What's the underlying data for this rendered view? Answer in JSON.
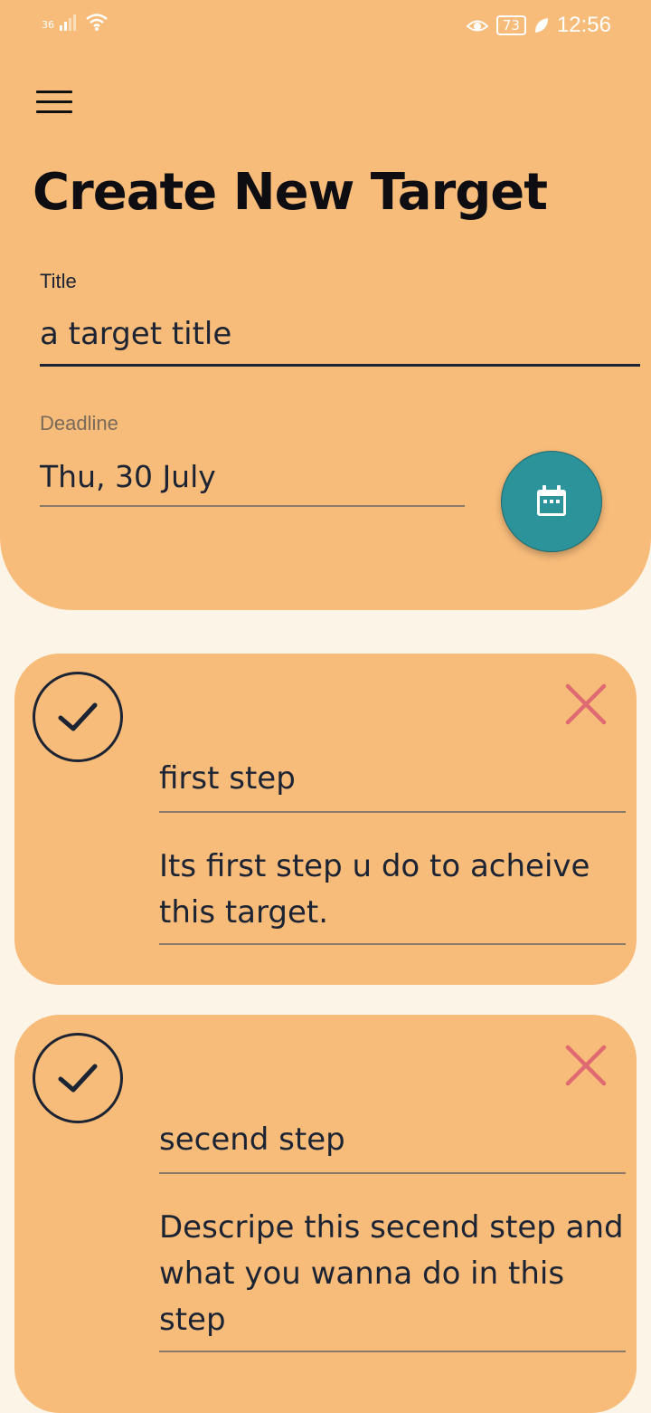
{
  "status_bar": {
    "network": "36",
    "battery": "73",
    "time": "12:56"
  },
  "header": {
    "title": "Create New Target",
    "title_field": {
      "label": "Title",
      "value": "a target title"
    },
    "deadline_field": {
      "label": "Deadline",
      "value": "Thu, 30 July"
    }
  },
  "steps": [
    {
      "name": "first step",
      "description": "Its first step u do to acheive this target."
    },
    {
      "name": "secend step",
      "description": "Descripe this secend step and what you wanna do in this step"
    }
  ],
  "colors": {
    "header_bg": "#f7bc7a",
    "page_bg": "#fdf4e8",
    "accent": "#2b9399",
    "delete": "#e06a72",
    "text": "#1c2333"
  }
}
